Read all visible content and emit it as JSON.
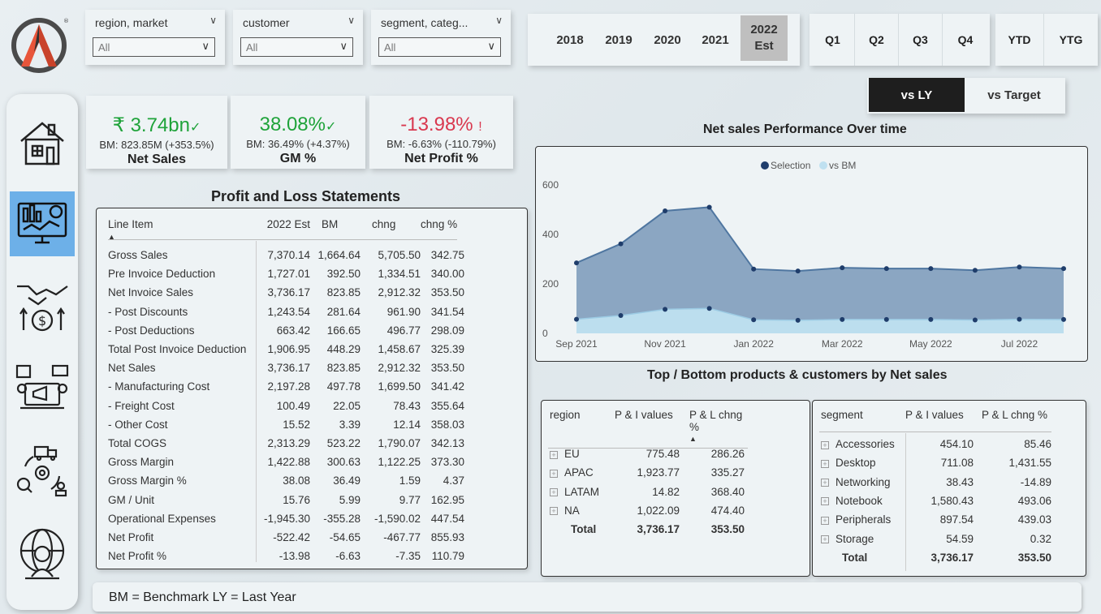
{
  "filters": [
    {
      "label": "region, market",
      "value": "All"
    },
    {
      "label": "customer",
      "value": "All"
    },
    {
      "label": "segment, categ...",
      "value": "All"
    }
  ],
  "years": [
    "2018",
    "2019",
    "2020",
    "2021"
  ],
  "selected_year": {
    "line1": "2022",
    "line2": "Est"
  },
  "quarters": [
    "Q1",
    "Q2",
    "Q3",
    "Q4"
  ],
  "ytd": [
    "YTD",
    "YTG"
  ],
  "toggle": {
    "active": "vs LY",
    "inactive": "vs Target"
  },
  "kpis": [
    {
      "value": "₹ 3.74bn",
      "mark": "✓",
      "bm": "BM: 823.85M (+353.5%)",
      "name": "Net Sales",
      "color": "#1fa33a"
    },
    {
      "value": "38.08%",
      "mark": "✓",
      "bm": "BM: 36.49% (+4.37%)",
      "name": "GM %",
      "color": "#1fa33a"
    },
    {
      "value": "-13.98%",
      "mark": "!",
      "bm": "BM: -6.63% (-110.79%)",
      "name": "Net Profit %",
      "color": "#d9384f"
    }
  ],
  "pnl": {
    "title": "Profit and Loss Statements",
    "headers": [
      "Line Item",
      "2022 Est",
      "BM",
      "chng",
      "chng %"
    ],
    "rows": [
      [
        "Gross Sales",
        "7,370.14",
        "1,664.64",
        "5,705.50",
        "342.75"
      ],
      [
        "Pre Invoice Deduction",
        "1,727.01",
        "392.50",
        "1,334.51",
        "340.00"
      ],
      [
        "Net Invoice Sales",
        "3,736.17",
        "823.85",
        "2,912.32",
        "353.50"
      ],
      [
        "- Post Discounts",
        "1,243.54",
        "281.64",
        "961.90",
        "341.54"
      ],
      [
        "- Post Deductions",
        "663.42",
        "166.65",
        "496.77",
        "298.09"
      ],
      [
        "Total Post Invoice Deduction",
        "1,906.95",
        "448.29",
        "1,458.67",
        "325.39"
      ],
      [
        "Net Sales",
        "3,736.17",
        "823.85",
        "2,912.32",
        "353.50"
      ],
      [
        "- Manufacturing Cost",
        "2,197.28",
        "497.78",
        "1,699.50",
        "341.42"
      ],
      [
        "- Freight Cost",
        "100.49",
        "22.05",
        "78.43",
        "355.64"
      ],
      [
        "- Other Cost",
        "15.52",
        "3.39",
        "12.14",
        "358.03"
      ],
      [
        "Total COGS",
        "2,313.29",
        "523.22",
        "1,790.07",
        "342.13"
      ],
      [
        "Gross Margin",
        "1,422.88",
        "300.63",
        "1,122.25",
        "373.30"
      ],
      [
        "Gross Margin %",
        "38.08",
        "36.49",
        "1.59",
        "4.37"
      ],
      [
        "GM / Unit",
        "15.76",
        "5.99",
        "9.77",
        "162.95"
      ],
      [
        "Operational Expenses",
        "-1,945.30",
        "-355.28",
        "-1,590.02",
        "447.54"
      ],
      [
        "Net Profit",
        "-522.42",
        "-54.65",
        "-467.77",
        "855.93"
      ],
      [
        "Net Profit %",
        "-13.98",
        "-6.63",
        "-7.35",
        "110.79"
      ]
    ]
  },
  "chart_title": "Net sales Performance Over time",
  "chart_data": {
    "type": "area",
    "x": [
      "Sep 2021",
      "Oct 2021",
      "Nov 2021",
      "Dec 2021",
      "Jan 2022",
      "Feb 2022",
      "Mar 2022",
      "Apr 2022",
      "May 2022",
      "Jun 2022",
      "Jul 2022",
      "Aug 2022"
    ],
    "x_tick_labels": [
      "Sep 2021",
      "Nov 2021",
      "Jan 2022",
      "Mar 2022",
      "May 2022",
      "Jul 2022"
    ],
    "series": [
      {
        "name": "Selection",
        "values": [
          285,
          362,
          495,
          510,
          260,
          252,
          265,
          262,
          262,
          255,
          268,
          262
        ],
        "color": "#1f3d6b"
      },
      {
        "name": "vs BM",
        "values": [
          57,
          72,
          97,
          101,
          55,
          53,
          56,
          56,
          56,
          54,
          57,
          56
        ],
        "color": "#bfe0f0"
      }
    ],
    "ylim": [
      0,
      600
    ],
    "y_ticks": [
      "0",
      "200",
      "400",
      "600"
    ],
    "legend": "top"
  },
  "top_bottom_title": "Top / Bottom products & customers by Net sales",
  "region_table": {
    "headers": [
      "region",
      "P & I values",
      "P & L chng %"
    ],
    "rows": [
      [
        "EU",
        "775.48",
        "286.26"
      ],
      [
        "APAC",
        "1,923.77",
        "335.27"
      ],
      [
        "LATAM",
        "14.82",
        "368.40"
      ],
      [
        "NA",
        "1,022.09",
        "474.40"
      ]
    ],
    "total": [
      "Total",
      "3,736.17",
      "353.50"
    ]
  },
  "segment_table": {
    "headers": [
      "segment",
      "P & I values",
      "P & L chng %"
    ],
    "rows": [
      [
        "Accessories",
        "454.10",
        "85.46"
      ],
      [
        "Desktop",
        "711.08",
        "1,431.55"
      ],
      [
        "Networking",
        "38.43",
        "-14.89"
      ],
      [
        "Notebook",
        "1,580.43",
        "493.06"
      ],
      [
        "Peripherals",
        "897.54",
        "439.03"
      ],
      [
        "Storage",
        "54.59",
        "0.32"
      ]
    ],
    "total": [
      "Total",
      "3,736.17",
      "353.50"
    ]
  },
  "footer": "BM = Benchmark  LY = Last Year",
  "nav_icons": [
    "home-icon",
    "dashboard-monitor-icon",
    "handshake-dollar-icon",
    "marketing-icon",
    "supply-chain-icon",
    "executive-globe-icon"
  ]
}
